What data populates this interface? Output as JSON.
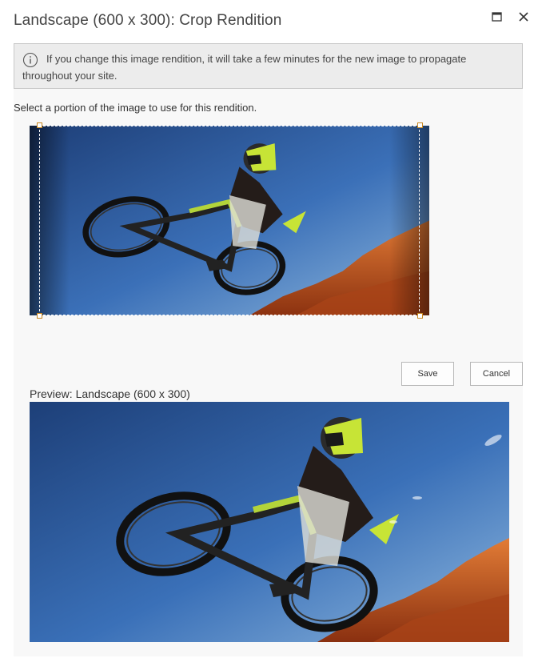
{
  "dialog": {
    "title": "Landscape (600 x 300): Crop Rendition"
  },
  "icons": {
    "maximize": "maximize-icon",
    "close": "close-icon",
    "info": "info-icon"
  },
  "info_bar": {
    "message": "If you change this image rendition, it will take a few minutes for the new image to propagate throughout your site."
  },
  "instruction": "Select a portion of the image to use for this rendition.",
  "buttons": {
    "save": "Save",
    "cancel": "Cancel"
  },
  "preview": {
    "label": "Preview: Landscape (600 x 300)"
  },
  "colors": {
    "handle_border": "#c8861f",
    "sky": "#3a6fb5",
    "rock": "#c65a1e",
    "helmet": "#c8e632"
  }
}
